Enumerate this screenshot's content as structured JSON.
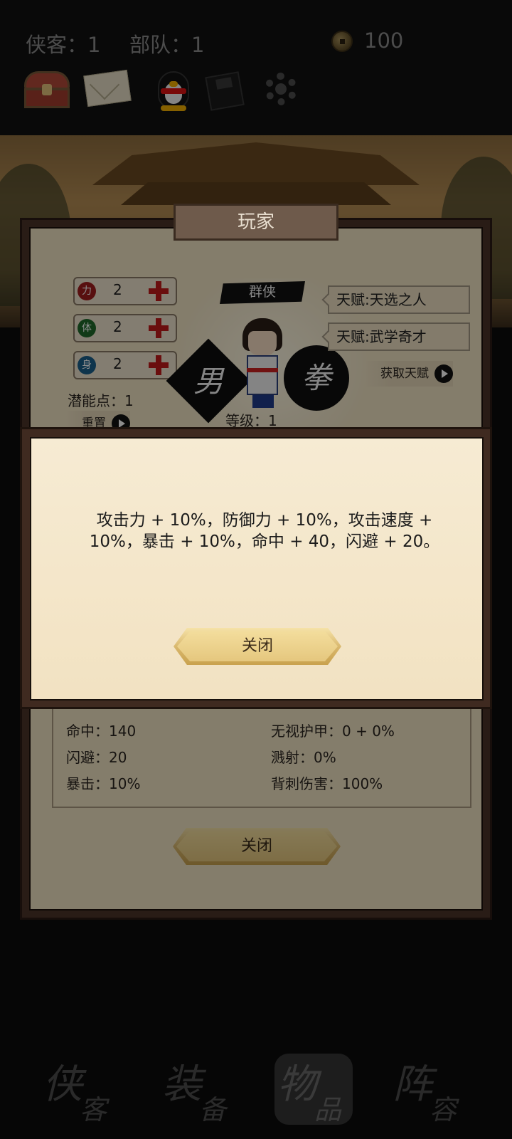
{
  "header": {
    "heroes_label": "侠客：1",
    "troops_label": "部队：1",
    "coins": "100",
    "tools": [
      "treasure-chest",
      "mail",
      "qq-penguin",
      "save-disk",
      "settings-gear"
    ]
  },
  "panel": {
    "title": "玩家",
    "faction": "群侠",
    "attributes": [
      {
        "glyph": "力",
        "value": "2",
        "color": "#a11e1e"
      },
      {
        "glyph": "体",
        "value": "2",
        "color": "#1f6b2a"
      },
      {
        "glyph": "身",
        "value": "2",
        "color": "#1b5f8a"
      }
    ],
    "potential": "潜能点：1",
    "reset": "重置",
    "level": "等级：1",
    "gender": "男",
    "style": "拳",
    "talents": [
      "天赋:天选之人",
      "天赋:武学奇才"
    ],
    "get_talent": "获取天赋",
    "stats": [
      {
        "left": "命中：140",
        "right": "无视护甲：0 + 0%"
      },
      {
        "left": "闪避：20",
        "right": "溅射：0%"
      },
      {
        "left": "暴击：10%",
        "right": "背刺伤害：100%"
      }
    ],
    "close": "关闭"
  },
  "dialog": {
    "text": "攻击力 + 10%，防御力 + 10%，攻击速度 + 10%，暴击 + 10%，命中 + 40，闪避 + 20。",
    "close": "关闭"
  },
  "nav": [
    {
      "big": "侠",
      "small": "客",
      "active": false
    },
    {
      "big": "装",
      "small": "备",
      "active": false
    },
    {
      "big": "物",
      "small": "品",
      "active": true
    },
    {
      "big": "阵",
      "small": "容",
      "active": false
    }
  ]
}
